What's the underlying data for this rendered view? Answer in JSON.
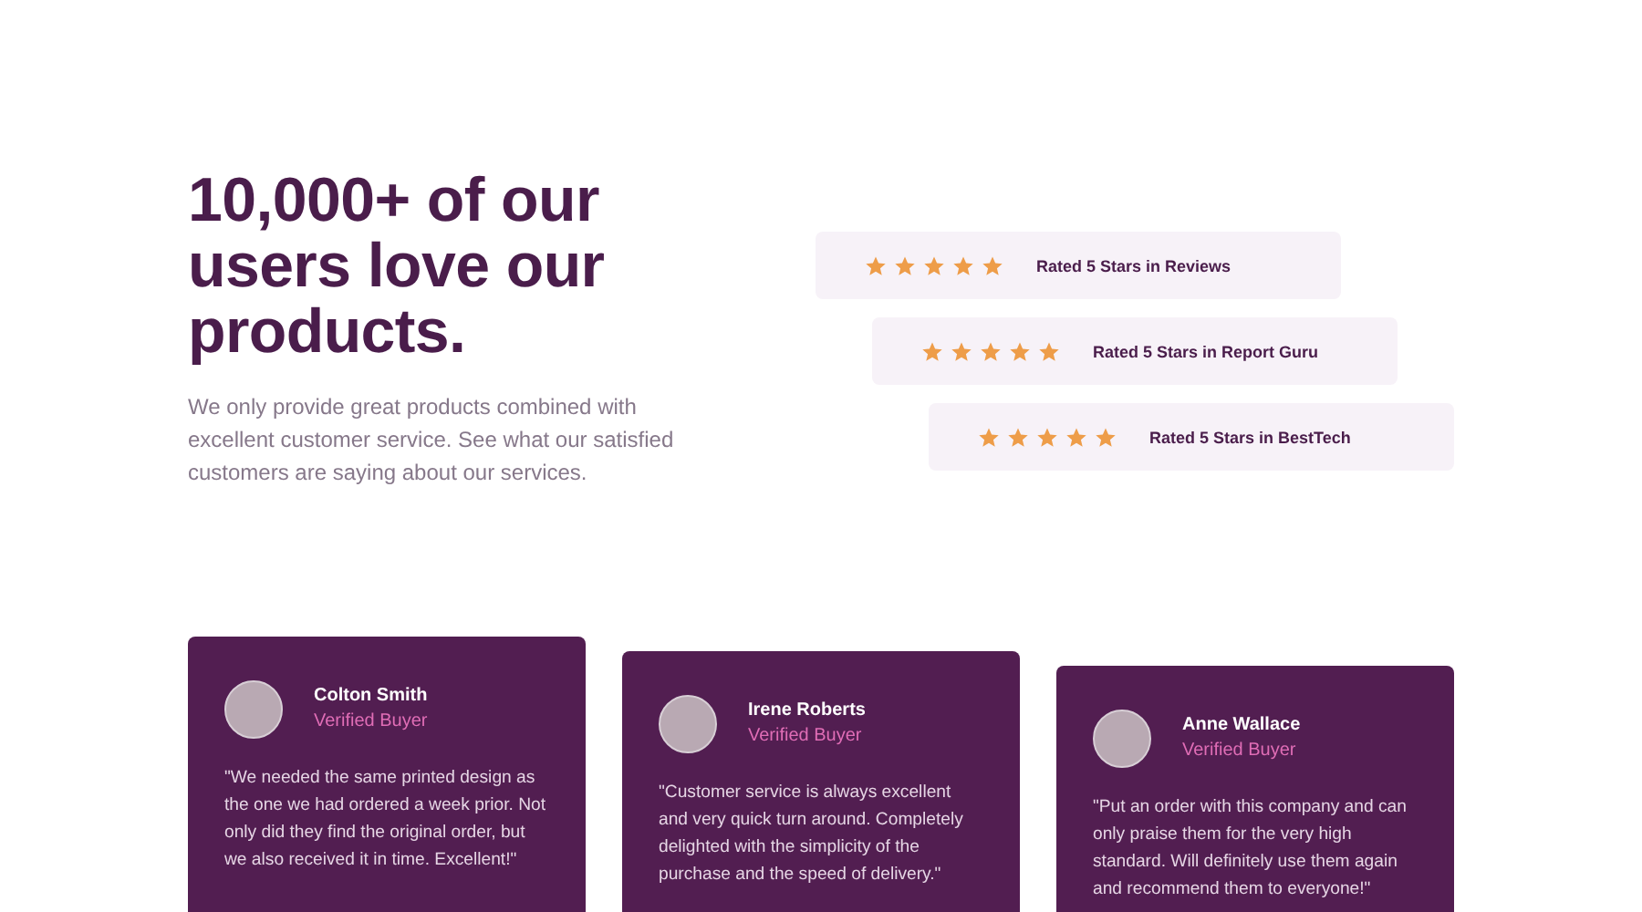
{
  "hero": {
    "heading": "10,000+ of our users love our products.",
    "description": "We only provide great products combined with excellent customer service. See what our satisfied customers are saying about our services."
  },
  "ratings": [
    {
      "stars": 5,
      "label": "Rated 5 Stars in Reviews"
    },
    {
      "stars": 5,
      "label": "Rated 5 Stars in Report Guru"
    },
    {
      "stars": 5,
      "label": "Rated 5 Stars in BestTech"
    }
  ],
  "testimonials": [
    {
      "name": "Colton Smith",
      "role": "Verified Buyer",
      "quote": "\"We needed the same printed design as the one we had ordered a week prior. Not only did they find the original order, but we also received it in time. Excellent!\""
    },
    {
      "name": "Irene Roberts",
      "role": "Verified Buyer",
      "quote": "\"Customer service is always excellent and very quick turn around. Completely delighted with the simplicity of the purchase and the speed of delivery.\""
    },
    {
      "name": "Anne Wallace",
      "role": "Verified Buyer",
      "quote": "\"Put an order with this company and can only praise them for the very high standard. Will definitely use them again and recommend them to everyone!\""
    }
  ]
}
